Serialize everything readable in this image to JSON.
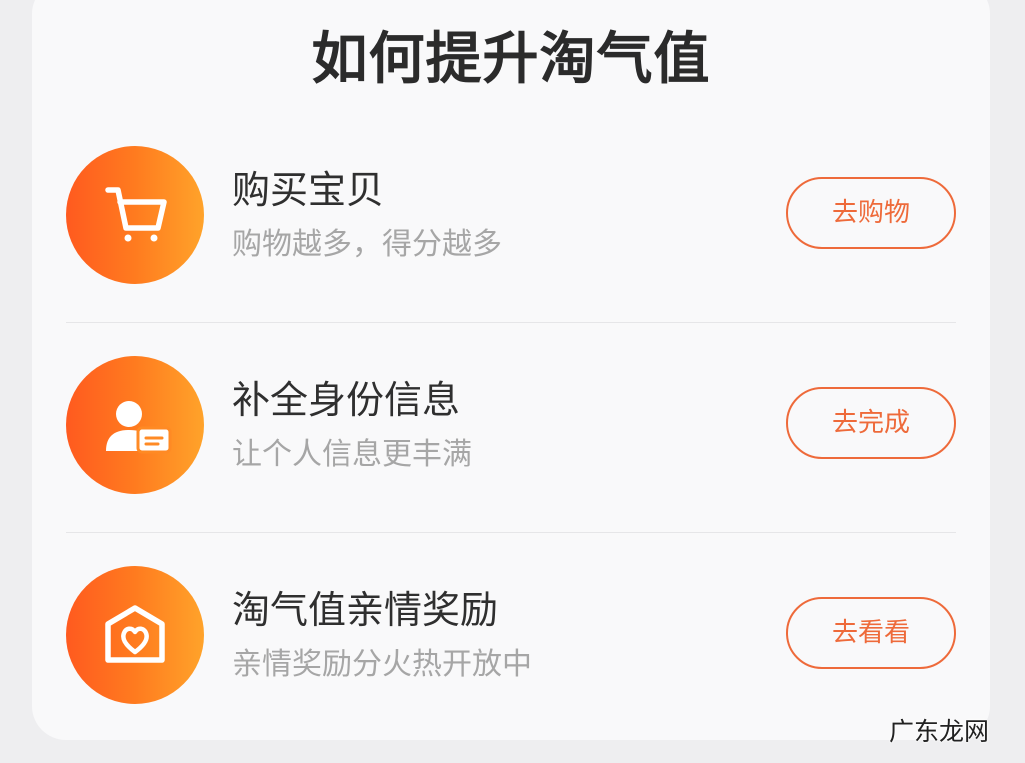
{
  "header": {
    "title": "如何提升淘气值"
  },
  "tasks": [
    {
      "title": "购买宝贝",
      "desc": "购物越多，得分越多",
      "button": "去购物",
      "icon": "shopping-cart-icon"
    },
    {
      "title": "补全身份信息",
      "desc": "让个人信息更丰满",
      "button": "去完成",
      "icon": "user-card-icon"
    },
    {
      "title": "淘气值亲情奖励",
      "desc": "亲情奖励分火热开放中",
      "button": "去看看",
      "icon": "home-heart-icon"
    }
  ],
  "watermark": "广东龙网",
  "colors": {
    "accent": "#ee6a3a",
    "gradient_start": "#ff5a1f",
    "gradient_end": "#ffa32a",
    "title_text": "#2b2b2b",
    "desc_text": "#a6a6a6"
  }
}
